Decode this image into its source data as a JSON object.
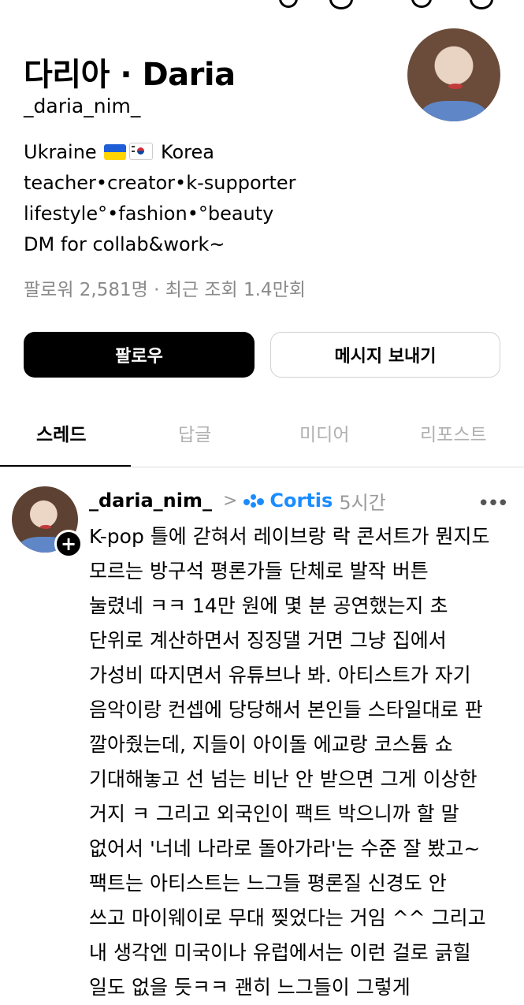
{
  "profile": {
    "display_name": "다리아 · Daria",
    "handle": "_daria_nim_",
    "bio_lines": {
      "line1_pre": "Ukraine ",
      "line1_post": " Korea",
      "line2": "teacher•creator•k-supporter",
      "line3": "lifestyle°•fashion•°beauty",
      "line4": "DM for collab&work~"
    },
    "stats": "팔로워 2,581명 · 최근 조회 1.4만회"
  },
  "actions": {
    "follow_label": "팔로우",
    "message_label": "메시지 보내기"
  },
  "tabs": [
    {
      "label": "스레드",
      "active": true
    },
    {
      "label": "답글",
      "active": false
    },
    {
      "label": "미디어",
      "active": false
    },
    {
      "label": "리포스트",
      "active": false
    }
  ],
  "post": {
    "author": "_daria_nim_",
    "separator": ">",
    "community_name": "Cortis",
    "time": "5시간",
    "more_icon": "ellipsis-icon",
    "body_lines": [
      "K-pop 틀에 갇혀서 레이브랑 락 콘서트가 뭔지도",
      "모르는 방구석 평론가들 단체로 발작 버튼",
      "눌렸네 ㅋㅋ 14만 원에 몇 분 공연했는지 초",
      "단위로 계산하면서 징징댈 거면 그냥 집에서",
      "가성비 따지면서 유튜브나 봐. 아티스트가 자기",
      "음악이랑 컨셉에 당당해서 본인들 스타일대로 판",
      "깔아줬는데, 지들이 아이돌 에교랑 코스튬 쇼",
      "기대해놓고 선 넘는 비난 안 받으면 그게 이상한",
      "거지 ㅋ 그리고 외국인이 팩트 박으니까 할 말",
      "없어서 '너네 나라로 돌아가라'는 수준 잘 봤고~",
      "팩트는 아티스트는 느그들 평론질 신경도 안",
      "쓰고 마이웨이로 무대 찢었다는 거임 ^^ 그리고",
      "내 생각엔 미국이나 유럽에서는 이런 걸로 긁힐",
      "일도 없을 듯ㅋㅋ 괜히 느그들이 그렇게"
    ]
  },
  "colors": {
    "accent_blue": "#1a8cff",
    "muted_text": "#8a8a8a",
    "primary_button": "#000000"
  }
}
